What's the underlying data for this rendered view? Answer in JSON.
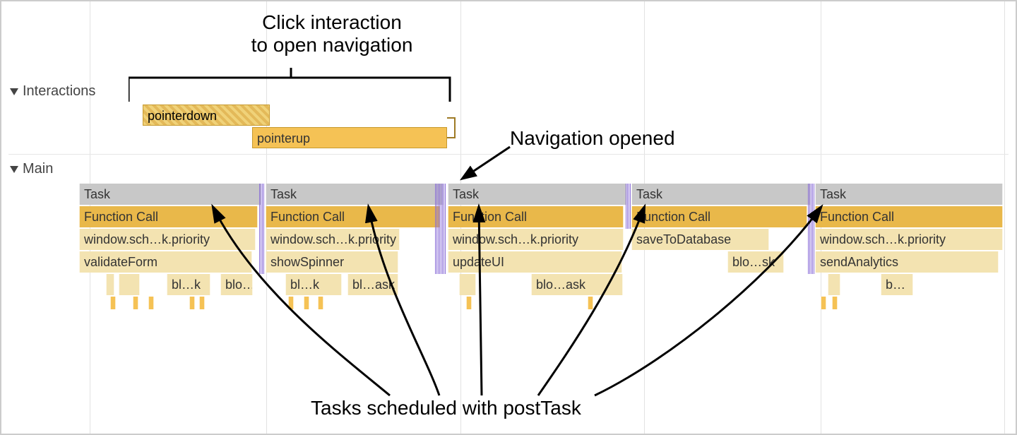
{
  "annotations": {
    "top_line1": "Click interaction",
    "top_line2": "to open navigation",
    "nav_opened": "Navigation opened",
    "bottom": "Tasks scheduled with postTask"
  },
  "tracks": {
    "interactions_label": "Interactions",
    "main_label": "Main"
  },
  "interactions": {
    "pointerdown": "pointerdown",
    "pointerup": "pointerup"
  },
  "tasks": {
    "task_label": "Task",
    "fn_call": "Function Call",
    "row3": {
      "c0": "window.sch…k.priority",
      "c1": "window.sch…k.priority",
      "c2": "window.sch…k.priority",
      "c3": "saveToDatabase",
      "c4": "window.sch…k.priority"
    },
    "row4": {
      "c0": "validateForm",
      "c1": "showSpinner",
      "c2": "updateUI",
      "c3": "blo…sk",
      "c4": "sendAnalytics"
    },
    "row5": {
      "b0": "bl…k",
      "b1": "blo…sk",
      "b2": "bl…k",
      "b3": "bl…ask",
      "b4": "blo…ask",
      "b5": "b…"
    }
  },
  "colors": {
    "task_gray": "#c8c8c8",
    "fn_gold": "#e9b84a",
    "detail_cream": "#f3e3b1",
    "interaction_yellow": "#f5c255"
  }
}
